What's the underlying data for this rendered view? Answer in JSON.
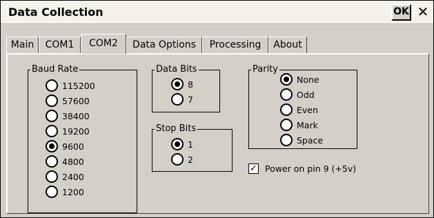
{
  "window": {
    "title": "Data Collection",
    "ok_label": "OK",
    "close_glyph": "✕"
  },
  "tabs": [
    {
      "label": "Main"
    },
    {
      "label": "COM1"
    },
    {
      "label": "COM2",
      "active": true
    },
    {
      "label": "Data Options"
    },
    {
      "label": "Processing"
    },
    {
      "label": "About"
    }
  ],
  "baud_rate": {
    "label": "Baud Rate",
    "selected": "9600",
    "options": [
      "115200",
      "57600",
      "38400",
      "19200",
      "9600",
      "4800",
      "2400",
      "1200"
    ]
  },
  "data_bits": {
    "label": "Data Bits",
    "selected": "8",
    "options": [
      "8",
      "7"
    ]
  },
  "stop_bits": {
    "label": "Stop Bits",
    "selected": "1",
    "options": [
      "1",
      "2"
    ]
  },
  "parity": {
    "label": "Parity",
    "selected": "None",
    "options": [
      "None",
      "Odd",
      "Even",
      "Mark",
      "Space"
    ]
  },
  "power_option": {
    "label": "Power on pin 9 (+5v)",
    "checked": true
  },
  "colors": {
    "face": "#d4d0c8",
    "titlebar": "#f5f2e9"
  }
}
